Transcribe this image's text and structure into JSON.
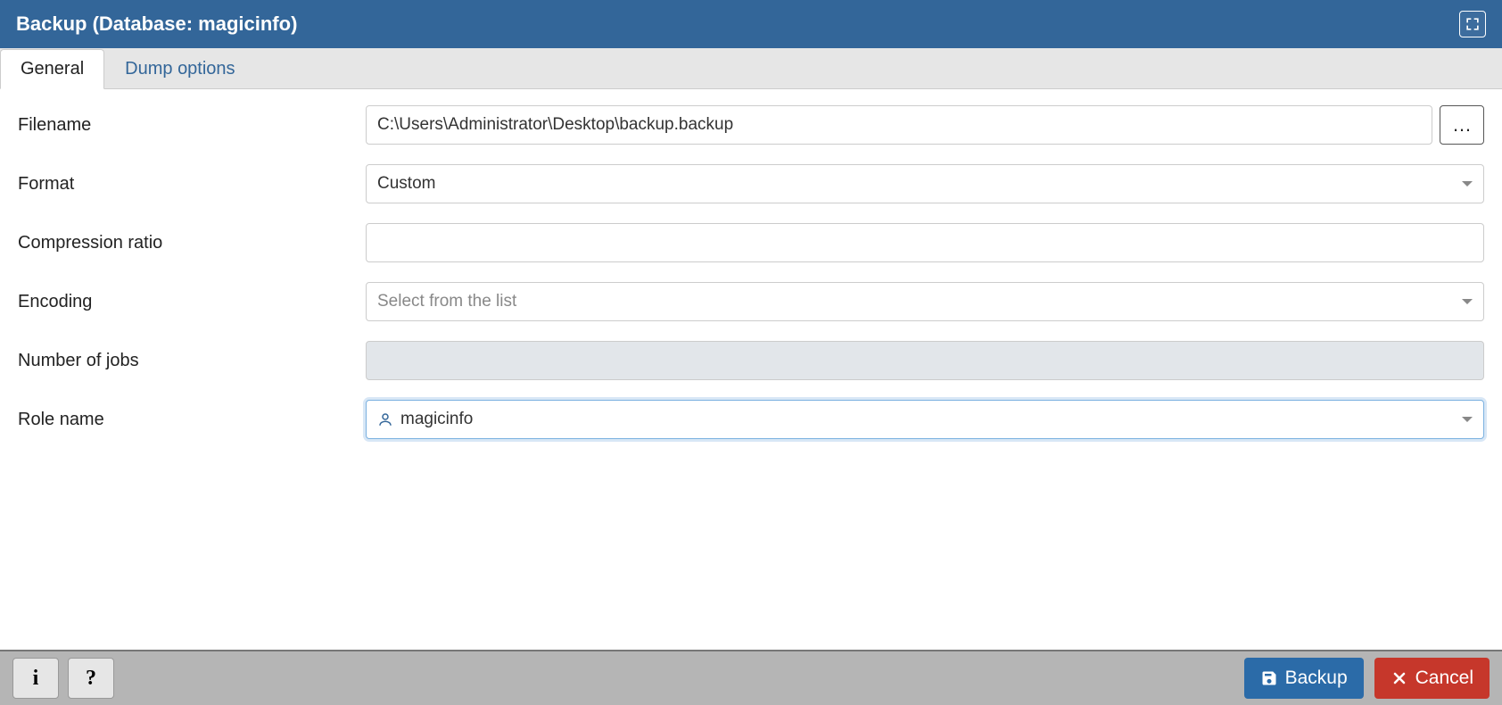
{
  "header": {
    "title": "Backup (Database: magicinfo)"
  },
  "tabs": [
    {
      "label": "General",
      "active": true
    },
    {
      "label": "Dump options",
      "active": false
    }
  ],
  "form": {
    "filename": {
      "label": "Filename",
      "value": "C:\\Users\\Administrator\\Desktop\\backup.backup"
    },
    "format": {
      "label": "Format",
      "value": "Custom"
    },
    "compression": {
      "label": "Compression ratio",
      "value": ""
    },
    "encoding": {
      "label": "Encoding",
      "placeholder": "Select from the list"
    },
    "jobs": {
      "label": "Number of jobs",
      "value": ""
    },
    "role": {
      "label": "Role name",
      "value": "magicinfo"
    }
  },
  "footer": {
    "info": "i",
    "help": "?",
    "backup": "Backup",
    "cancel": "Cancel"
  }
}
